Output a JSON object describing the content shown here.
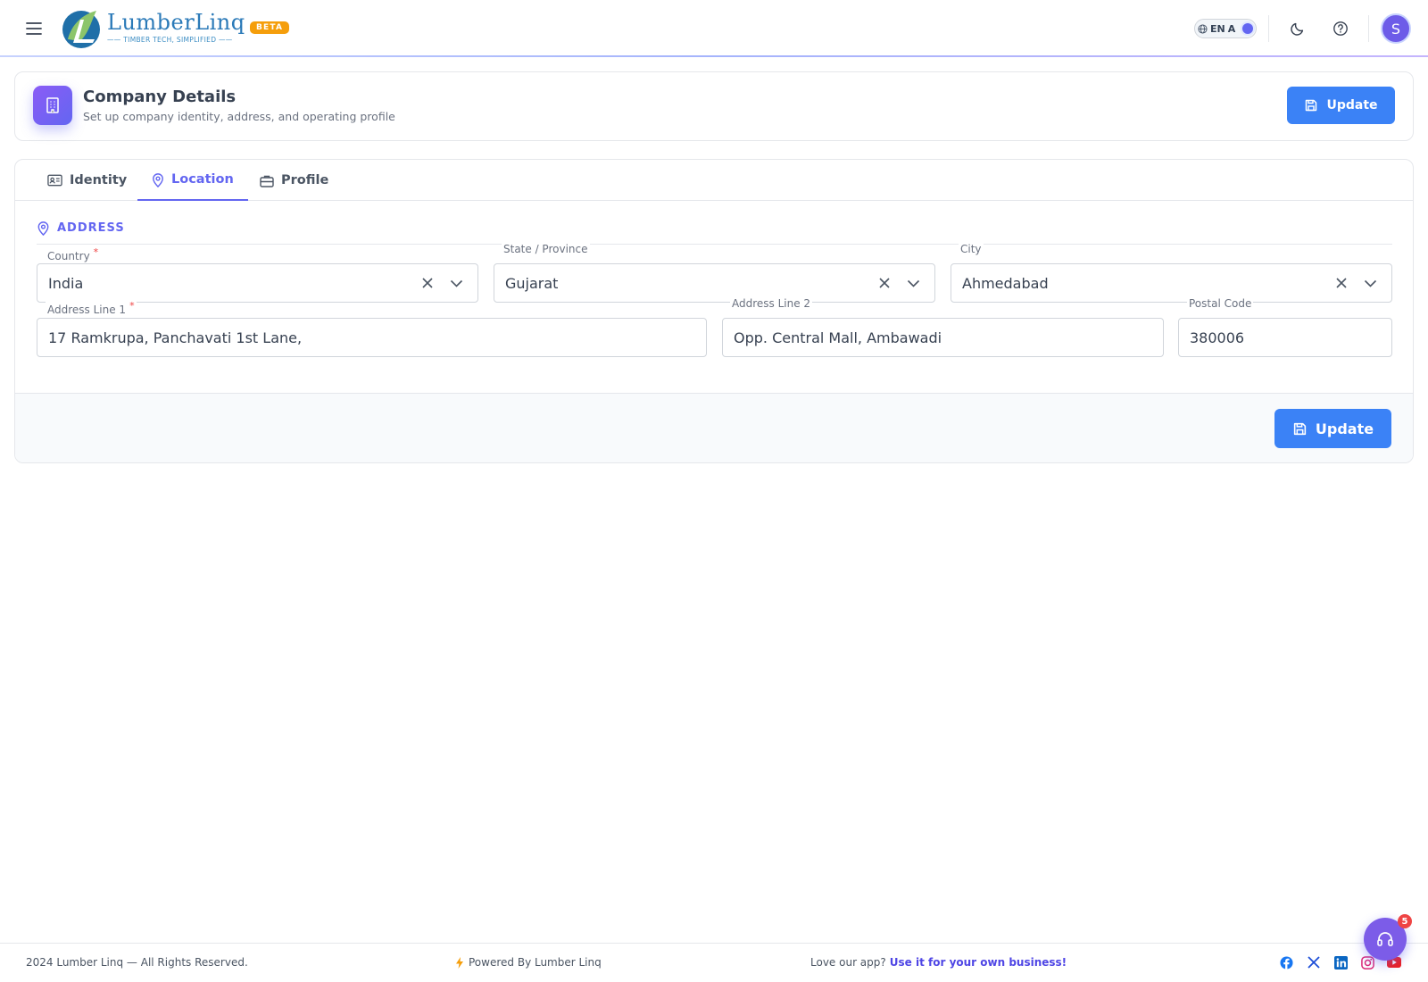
{
  "header": {
    "brand_name": "LumberLinq",
    "brand_tagline": "TIMBER TECH, SIMPLIFIED",
    "beta_label": "BETA",
    "language_code": "EN",
    "language_letter": "A",
    "avatar_initial": "S",
    "icons": [
      "menu-icon",
      "globe-icon",
      "moon-icon",
      "help-icon"
    ]
  },
  "page": {
    "title": "Company Details",
    "subtitle": "Set up company identity, address, and operating profile",
    "update_label": "Update"
  },
  "tabs": [
    {
      "label": "Identity",
      "icon": "id-card-icon",
      "active": false
    },
    {
      "label": "Location",
      "icon": "map-pin-icon",
      "active": true
    },
    {
      "label": "Profile",
      "icon": "briefcase-icon",
      "active": false
    }
  ],
  "address": {
    "section_title": "ADDRESS",
    "country": {
      "label": "Country",
      "value": "India",
      "required": true
    },
    "state": {
      "label": "State / Province",
      "value": "Gujarat",
      "required": false
    },
    "city": {
      "label": "City",
      "value": "Ahmedabad",
      "required": false
    },
    "address_line1": {
      "label": "Address Line 1",
      "value": "17 Ramkrupa, Panchavati 1st Lane,",
      "required": true
    },
    "address_line2": {
      "label": "Address Line 2",
      "value": "Opp. Central Mall, Ambawadi",
      "required": false
    },
    "postal_code": {
      "label": "Postal Code",
      "value": "380006",
      "required": false
    },
    "required_marker": "*"
  },
  "footer_card": {
    "update_label": "Update"
  },
  "page_footer": {
    "copyright": "2024 Lumber Linq — All Rights Reserved.",
    "powered_by": "Powered By Lumber Linq",
    "love_text": "Love our app?",
    "love_link": "Use it for your own business!",
    "social": [
      "facebook-icon",
      "x-icon",
      "linkedin-icon",
      "instagram-icon",
      "youtube-icon"
    ]
  },
  "support": {
    "badge_count": "5"
  },
  "colors": {
    "accent": "#6366f1",
    "primary_button": "#3b82f6",
    "beta_badge": "#f59e0b",
    "required": "#ef4444"
  }
}
